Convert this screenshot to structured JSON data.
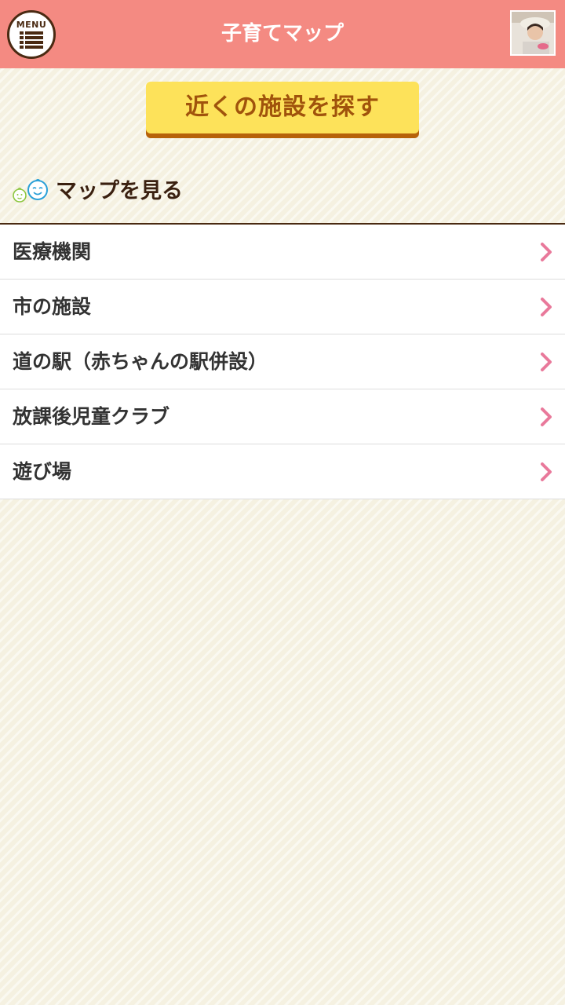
{
  "header": {
    "menu_label": "MENU",
    "title": "子育てマップ",
    "menu_icon": "list-icon",
    "avatar": "profile-photo"
  },
  "search_button": {
    "label": "近くの施設を探す"
  },
  "section": {
    "icon": "baby-faces-icon",
    "title": "マップを見る"
  },
  "list": {
    "items": [
      {
        "label": "医療機関"
      },
      {
        "label": "市の施設"
      },
      {
        "label": "道の駅（赤ちゃんの駅併設）"
      },
      {
        "label": "放課後児童クラブ"
      },
      {
        "label": "遊び場"
      }
    ]
  },
  "colors": {
    "header_bg": "#f48a82",
    "button_bg": "#fde25a",
    "button_text": "#a0530c",
    "chevron": "#e9799b",
    "page_bg": "#f5f1e1"
  }
}
